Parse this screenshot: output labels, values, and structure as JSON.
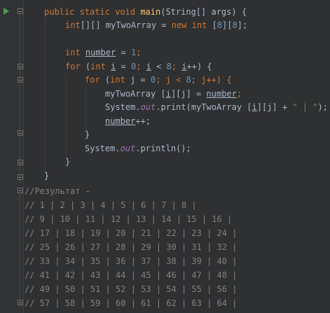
{
  "code": {
    "l1": {
      "kw1": "public",
      "kw2": "static",
      "kw3": "void",
      "fn": "main",
      "rest": "(String[] args) {"
    },
    "l2": {
      "kw": "int",
      "mid": "[][] myTwoArray = ",
      "kw2": "new",
      "kw3": "int",
      "p1": " [",
      "n1": "8",
      "p2": "][",
      "n2": "8",
      "p3": "];"
    },
    "l3": {
      "kw": "int",
      "sp": " ",
      "var": "number",
      "eq": " = ",
      "num": "1",
      "end": ";"
    },
    "l4": {
      "kw": "for",
      "a": " (",
      "kw2": "int",
      "sp": " ",
      "v1": "i",
      "b": " = ",
      "n0": "0",
      "c": "; ",
      "v2": "i",
      "d": " < ",
      "n8": "8",
      "e": "; ",
      "v3": "i",
      "f": "++) {"
    },
    "l5": {
      "kw": "for",
      "a": " (",
      "kw2": "int",
      "b": " j = ",
      "n0": "0",
      "c": "; j < ",
      "n8": "8",
      "d": "; j++) {"
    },
    "l6": {
      "a": "myTwoArray [",
      "v1": "i",
      "b": "][j] = ",
      "v2": "number",
      "c": ";"
    },
    "l7": {
      "a": "System.",
      "fld": "out",
      "b": ".print(myTwoArray [",
      "v1": "i",
      "c": "][j] + ",
      "str": "\" | \"",
      "d": ");"
    },
    "l8": {
      "v": "number",
      "a": "++;"
    },
    "l9": "}",
    "l10": {
      "a": "System.",
      "fld": "out",
      "b": ".println();"
    },
    "l11": "}",
    "l12": "}",
    "comments": [
      "//Результат -",
      "// 1 | 2 | 3 | 4 | 5 | 6 | 7 | 8 |",
      "// 9 | 10 | 11 | 12 | 13 | 14 | 15 | 16 |",
      "// 17 | 18 | 19 | 20 | 21 | 22 | 23 | 24 |",
      "// 25 | 26 | 27 | 28 | 29 | 30 | 31 | 32 |",
      "// 33 | 34 | 35 | 36 | 37 | 38 | 39 | 40 |",
      "// 41 | 42 | 43 | 44 | 45 | 46 | 47 | 48 |",
      "// 49 | 50 | 51 | 52 | 53 | 54 | 55 | 56 |",
      "// 57 | 58 | 59 | 60 | 61 | 62 | 63 | 64 |"
    ]
  },
  "colors": {
    "background": "#2b2b2b",
    "gutter": "#313335",
    "keyword": "#cc7832",
    "method": "#ffc66d",
    "number": "#6897bb",
    "string": "#6a8759",
    "field": "#9876aa",
    "comment": "#808080",
    "text": "#a9b7c6",
    "run": "#499c54"
  },
  "icons": {
    "run": "run-triangle-icon",
    "fold": "fold-marker-icon"
  }
}
